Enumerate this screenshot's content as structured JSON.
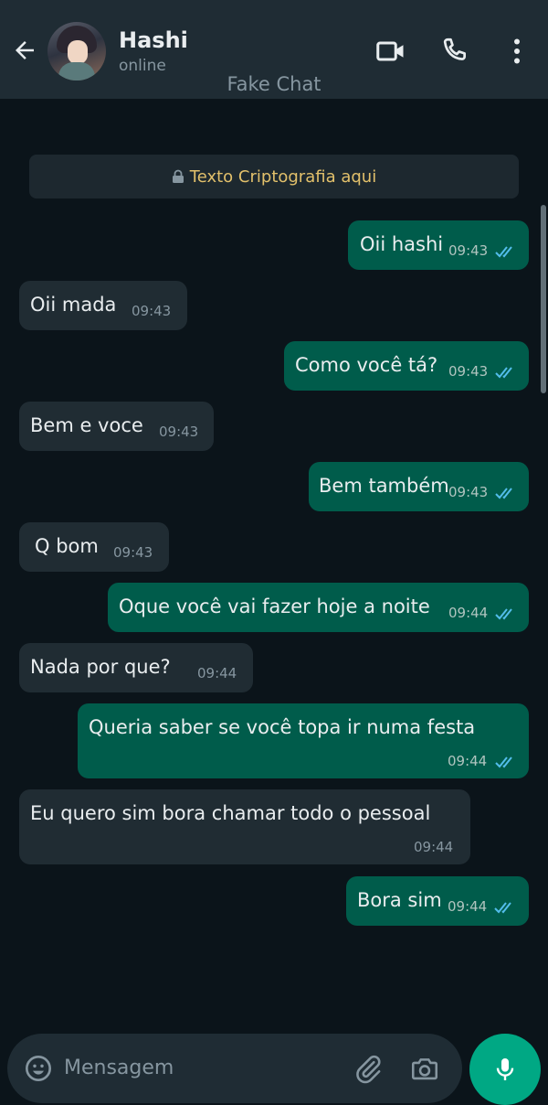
{
  "header": {
    "contact_name": "Hashi",
    "status": "online",
    "watermark": "Fake Chat",
    "icons": [
      "arrow-back-icon",
      "avatar",
      "video-call-icon",
      "phone-icon",
      "more-vert-icon"
    ]
  },
  "encryption_notice": "Texto Criptografia aqui",
  "messages": [
    {
      "dir": "out",
      "text": "Oii hashi",
      "time": "09:43",
      "status": "read"
    },
    {
      "dir": "in",
      "text": "Oii mada",
      "time": "09:43"
    },
    {
      "dir": "out",
      "text": "Como você tá?",
      "time": "09:43",
      "status": "read"
    },
    {
      "dir": "in",
      "text": "Bem e voce",
      "time": "09:43"
    },
    {
      "dir": "out",
      "text": "Bem também",
      "time": "09:43",
      "status": "read"
    },
    {
      "dir": "in",
      "text": "Q bom",
      "time": "09:43"
    },
    {
      "dir": "out",
      "text": "Oque você vai fazer hoje a noite",
      "time": "09:44",
      "status": "read"
    },
    {
      "dir": "in",
      "text": "Nada por que?",
      "time": "09:44"
    },
    {
      "dir": "out",
      "text": "Queria saber se você topa ir numa festa",
      "time": "09:44",
      "status": "read"
    },
    {
      "dir": "in",
      "text": "Eu quero sim bora chamar todo o pessoal",
      "time": "09:44"
    },
    {
      "dir": "out",
      "text": "Bora sim",
      "time": "09:44",
      "status": "read"
    }
  ],
  "composer": {
    "placeholder": "Mensagem",
    "icons": [
      "emoji-icon",
      "attach-icon",
      "camera-icon",
      "mic-icon"
    ]
  },
  "colors": {
    "outgoing_bubble": "#005c4b",
    "incoming_bubble": "#202c33",
    "read_ticks": "#53bdeb",
    "accent": "#00a884"
  }
}
